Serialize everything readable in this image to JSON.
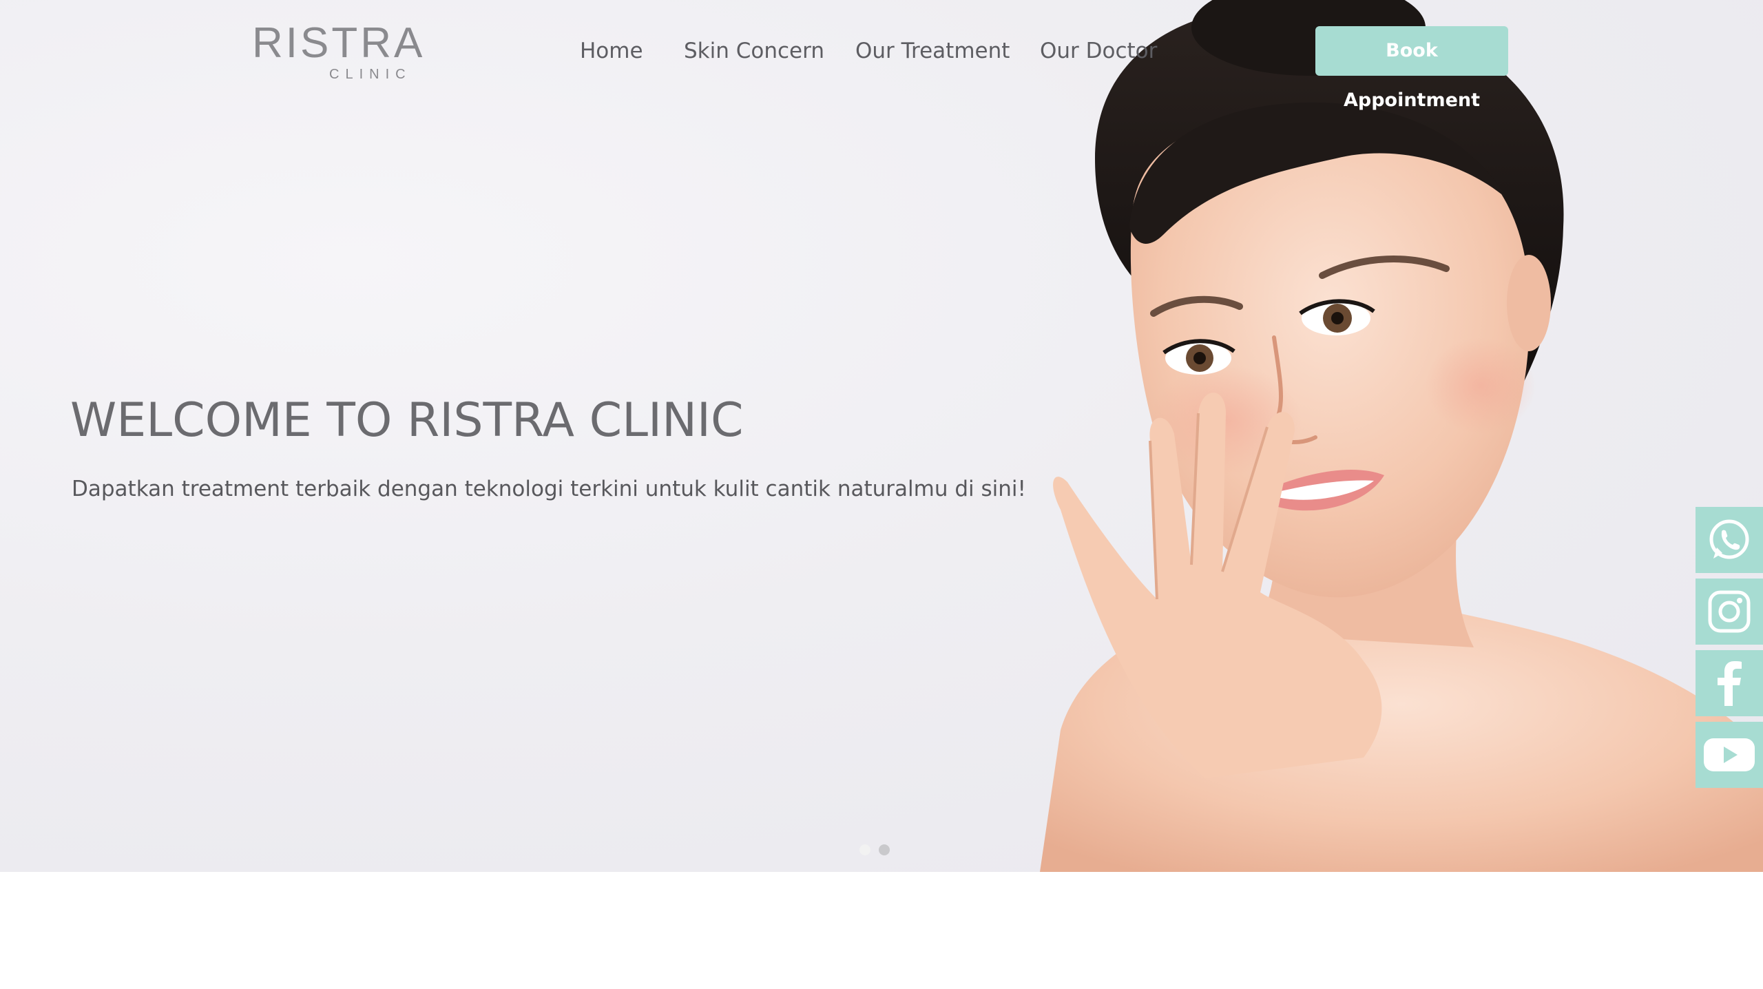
{
  "brand": {
    "name": "RISTRA",
    "sub": "CLINIC"
  },
  "nav": {
    "items": [
      {
        "label": "Home"
      },
      {
        "label": "Skin Concern"
      },
      {
        "label": "Our Treatment"
      },
      {
        "label": "Our Doctor"
      }
    ],
    "cta_label": "Book Appointment"
  },
  "hero": {
    "title": "WELCOME TO RISTRA CLINIC",
    "subtitle": "Dapatkan treatment terbaik dengan teknologi terkini untuk kulit cantik naturalmu di sini!",
    "slides": {
      "count": 2,
      "active": 1
    }
  },
  "social": {
    "items": [
      {
        "icon": "whatsapp-icon"
      },
      {
        "icon": "instagram-icon"
      },
      {
        "icon": "facebook-icon"
      },
      {
        "icon": "youtube-icon"
      }
    ]
  },
  "colors": {
    "accent": "#a7dcd2",
    "text_gray": "#6b6b6f",
    "hero_bg": "#efeef2"
  }
}
